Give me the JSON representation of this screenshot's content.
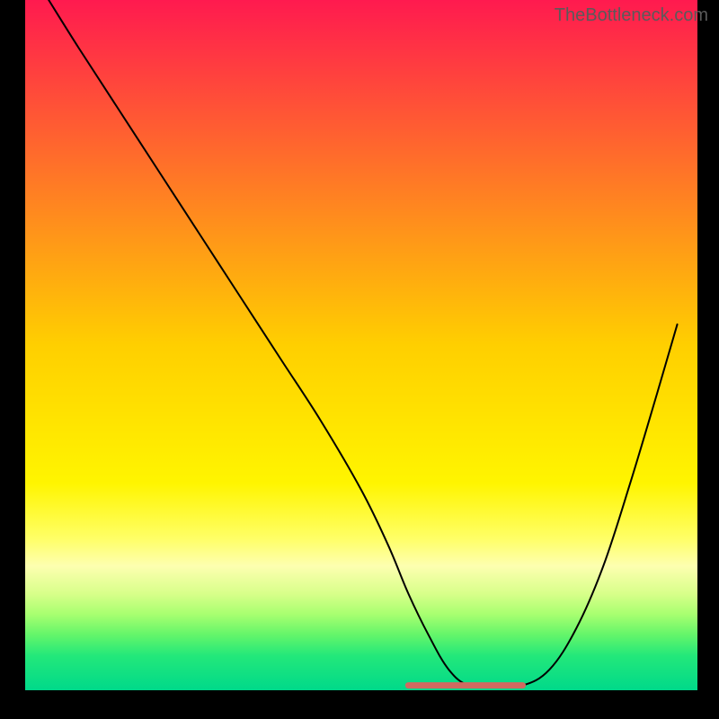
{
  "watermark": "TheBottleneck.com",
  "chart_data": {
    "type": "line",
    "title": "",
    "xlabel": "",
    "ylabel": "",
    "xlim": [
      0,
      100
    ],
    "ylim": [
      0,
      100
    ],
    "background": {
      "type": "vertical-gradient",
      "stops": [
        {
          "offset": 0.0,
          "color": "#ff1a4f"
        },
        {
          "offset": 0.5,
          "color": "#ffcf00"
        },
        {
          "offset": 0.7,
          "color": "#fff500"
        },
        {
          "offset": 0.78,
          "color": "#ffff66"
        },
        {
          "offset": 0.82,
          "color": "#fdffb0"
        },
        {
          "offset": 0.86,
          "color": "#d8ff8a"
        },
        {
          "offset": 0.89,
          "color": "#a8ff70"
        },
        {
          "offset": 0.92,
          "color": "#63f56a"
        },
        {
          "offset": 0.95,
          "color": "#23e87a"
        },
        {
          "offset": 1.0,
          "color": "#00d98a"
        }
      ]
    },
    "frame": {
      "left": 3.5,
      "right": 3.0,
      "bottom": 4.0,
      "top_open": true,
      "color": "#000000"
    },
    "series": [
      {
        "name": "bottleneck-curve",
        "color": "#000000",
        "stroke_width": 2,
        "x": [
          3.5,
          8,
          14,
          20,
          26,
          32,
          38,
          44,
          50,
          54,
          57,
          60,
          63,
          66,
          70,
          74,
          78,
          82,
          86,
          90,
          94,
          97
        ],
        "y": [
          100,
          93,
          84,
          75,
          66,
          57,
          48,
          39,
          29,
          21,
          14,
          8,
          3,
          0.7,
          0.7,
          0.7,
          3,
          9,
          18,
          30,
          43,
          53
        ]
      },
      {
        "name": "optimal-flat-segment",
        "color": "#d06a60",
        "stroke_width": 7,
        "linecap": "round",
        "x": [
          57,
          74
        ],
        "y": [
          0.7,
          0.7
        ]
      }
    ]
  }
}
